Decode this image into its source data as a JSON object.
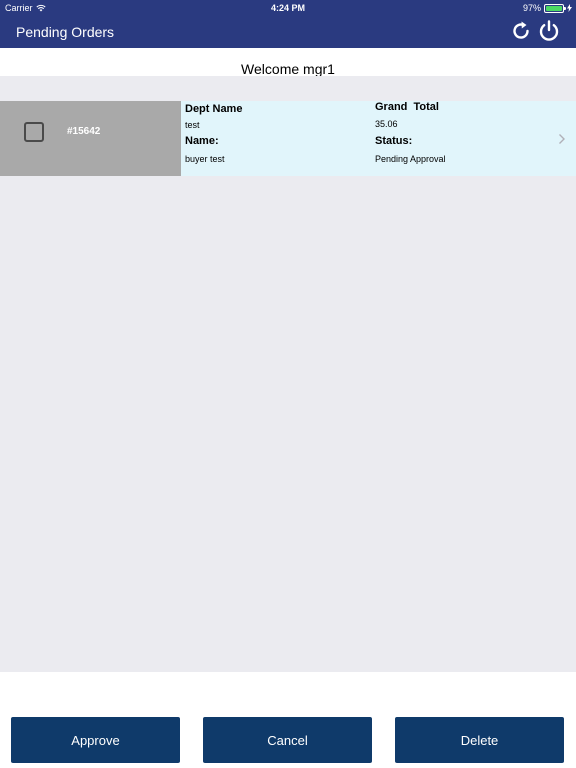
{
  "status_bar": {
    "carrier": "Carrier",
    "time": "4:24 PM",
    "battery": "97%",
    "battery_level": 0.97
  },
  "navbar": {
    "title": "Pending Orders",
    "icons": [
      "refresh-icon",
      "power-icon"
    ]
  },
  "welcome": {
    "text": "Welcome mgr1"
  },
  "orders": [
    {
      "order_number": "#15642",
      "dept_name_label": "Dept Name",
      "dept_name": "test",
      "name_label": "Name:",
      "name": "buyer test",
      "grand_total_label": "Grand  Total",
      "grand_total": "35.06",
      "status_label": "Status:",
      "status": "Pending Approval"
    }
  ],
  "actions": {
    "approve": "Approve",
    "cancel": "Cancel",
    "delete": "Delete"
  },
  "colors": {
    "navbar": "#2a3a80",
    "button": "#0f3a6a",
    "row_detail": "#e1f5fb",
    "row_left": "#a9a9a9",
    "list_bg": "#ebebf0"
  }
}
